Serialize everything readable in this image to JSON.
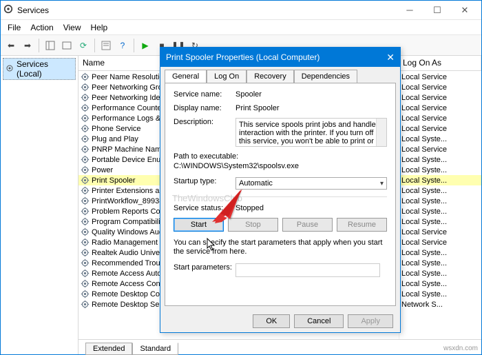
{
  "window": {
    "title": "Services"
  },
  "menu": {
    "file": "File",
    "action": "Action",
    "view": "View",
    "help": "Help"
  },
  "left": {
    "root": "Services (Local)"
  },
  "columns": {
    "name": "Name",
    "logon": "Log On As"
  },
  "services": [
    {
      "name": "Peer Name Resolution ...",
      "logon": "Local Service"
    },
    {
      "name": "Peer Networking Grou...",
      "logon": "Local Service"
    },
    {
      "name": "Peer Networking Ident...",
      "logon": "Local Service"
    },
    {
      "name": "Performance Counter ...",
      "logon": "Local Service"
    },
    {
      "name": "Performance Logs & A...",
      "logon": "Local Service"
    },
    {
      "name": "Phone Service",
      "logon": "Local Service"
    },
    {
      "name": "Plug and Play",
      "logon": "Local Syste..."
    },
    {
      "name": "PNRP Machine Name ...",
      "logon": "Local Service"
    },
    {
      "name": "Portable Device Enum...",
      "logon": "Local Syste..."
    },
    {
      "name": "Power",
      "logon": "Local Syste..."
    },
    {
      "name": "Print Spooler",
      "logon": "Local Syste...",
      "selected": true
    },
    {
      "name": "Printer Extensions and...",
      "logon": "Local Syste..."
    },
    {
      "name": "PrintWorkflow_89938",
      "logon": "Local Syste..."
    },
    {
      "name": "Problem Reports Cont...",
      "logon": "Local Syste..."
    },
    {
      "name": "Program Compatibilit...",
      "logon": "Local Syste..."
    },
    {
      "name": "Quality Windows Audi...",
      "logon": "Local Service"
    },
    {
      "name": "Radio Management Se...",
      "logon": "Local Service"
    },
    {
      "name": "Realtek Audio Univers...",
      "logon": "Local Syste..."
    },
    {
      "name": "Recommended Troubl...",
      "logon": "Local Syste..."
    },
    {
      "name": "Remote Access Auto C...",
      "logon": "Local Syste..."
    },
    {
      "name": "Remote Access Conne...",
      "logon": "Local Syste..."
    },
    {
      "name": "Remote Desktop Confi...",
      "logon": "Local Syste..."
    },
    {
      "name": "Remote Desktop Servi...",
      "logon": "Network S..."
    }
  ],
  "tabs": {
    "extended": "Extended",
    "standard": "Standard"
  },
  "dialog": {
    "title": "Print Spooler Properties (Local Computer)",
    "tabs": {
      "general": "General",
      "logon": "Log On",
      "recovery": "Recovery",
      "deps": "Dependencies"
    },
    "labels": {
      "service_name": "Service name:",
      "display_name": "Display name:",
      "description": "Description:",
      "path": "Path to executable:",
      "startup_type": "Startup type:",
      "service_status": "Service status:",
      "start_params": "Start parameters:"
    },
    "values": {
      "service_name": "Spooler",
      "display_name": "Print Spooler",
      "description": "This service spools print jobs and handles interaction with the printer.  If you turn off this service, you won't be able to print or see your printers.",
      "path": "C:\\WINDOWS\\System32\\spoolsv.exe",
      "startup_type": "Automatic",
      "service_status": "Stopped",
      "hint": "You can specify the start parameters that apply when you start the service from here."
    },
    "buttons": {
      "start": "Start",
      "stop": "Stop",
      "pause": "Pause",
      "resume": "Resume",
      "ok": "OK",
      "cancel": "Cancel",
      "apply": "Apply"
    }
  },
  "watermark": "TheWindowsClub",
  "footer": "wsxdn.com"
}
